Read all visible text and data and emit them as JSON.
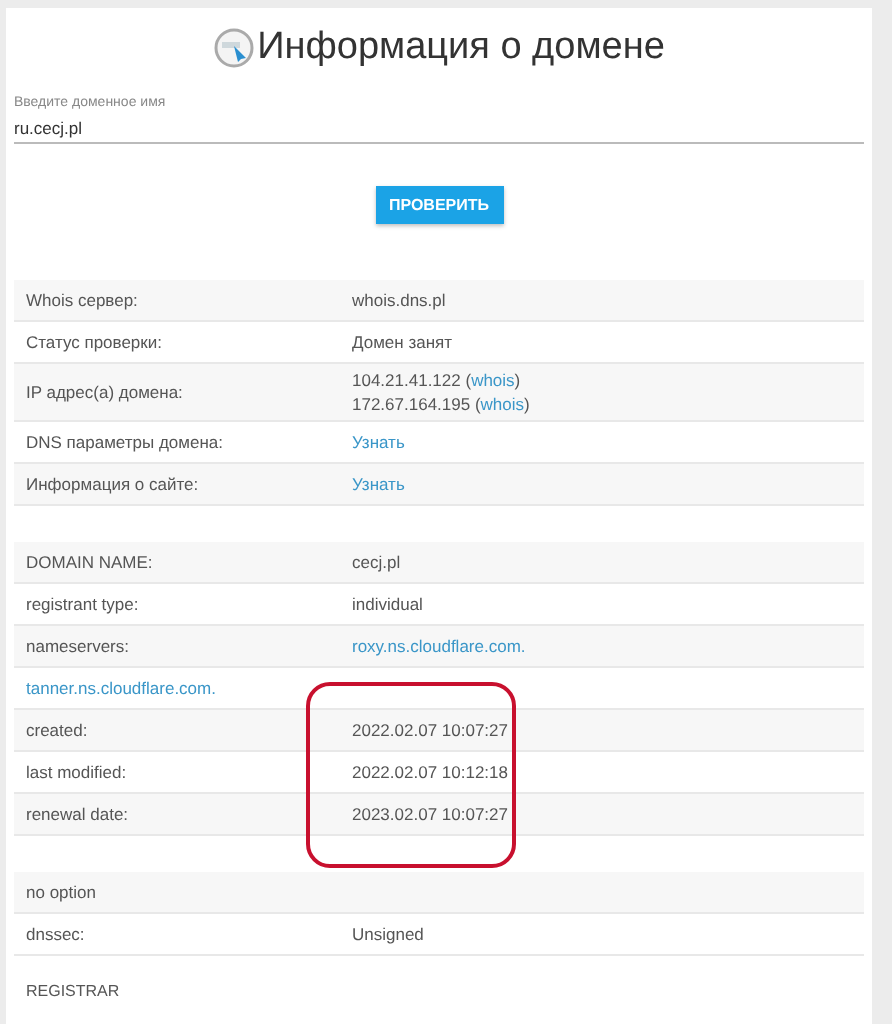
{
  "header": {
    "title": "Информация о домене"
  },
  "domain_field": {
    "label": "Введите доменное имя",
    "value": "ru.cecj.pl"
  },
  "check_button": {
    "label": "ПРОВЕРИТЬ"
  },
  "tables": [
    {
      "rows": [
        {
          "cells": [
            [
              [
                {
                  "text": "Whois сервер:",
                  "link": false
                }
              ]
            ],
            [
              [
                {
                  "text": "whois.dns.pl",
                  "link": false
                }
              ]
            ]
          ]
        },
        {
          "cells": [
            [
              [
                {
                  "text": "Статус проверки:",
                  "link": false
                }
              ]
            ],
            [
              [
                {
                  "text": "Домен занят",
                  "link": false
                }
              ]
            ]
          ]
        },
        {
          "cells": [
            [
              [
                {
                  "text": "IP адрес(а) домена:",
                  "link": false
                }
              ]
            ],
            [
              [
                {
                  "text": "104.21.41.122 (",
                  "link": false
                },
                {
                  "text": "whois",
                  "link": true
                },
                {
                  "text": ")",
                  "link": false
                }
              ],
              [
                {
                  "text": "172.67.164.195 (",
                  "link": false
                },
                {
                  "text": "whois",
                  "link": true
                },
                {
                  "text": ")",
                  "link": false
                }
              ]
            ]
          ]
        },
        {
          "cells": [
            [
              [
                {
                  "text": "DNS параметры домена:",
                  "link": false
                }
              ]
            ],
            [
              [
                {
                  "text": "Узнать",
                  "link": true
                }
              ]
            ]
          ]
        },
        {
          "cells": [
            [
              [
                {
                  "text": "Информация о сайте:",
                  "link": false
                }
              ]
            ],
            [
              [
                {
                  "text": "Узнать",
                  "link": true
                }
              ]
            ]
          ]
        }
      ]
    },
    {
      "rows": [
        {
          "cells": [
            [
              [
                {
                  "text": "DOMAIN NAME:",
                  "link": false
                }
              ]
            ],
            [
              [
                {
                  "text": "cecj.pl",
                  "link": false
                }
              ]
            ]
          ]
        },
        {
          "cells": [
            [
              [
                {
                  "text": "registrant type:",
                  "link": false
                }
              ]
            ],
            [
              [
                {
                  "text": "individual",
                  "link": false
                }
              ]
            ]
          ]
        },
        {
          "cells": [
            [
              [
                {
                  "text": "nameservers:",
                  "link": false
                }
              ]
            ],
            [
              [
                {
                  "text": "roxy.ns.cloudflare.com.",
                  "link": true
                }
              ]
            ]
          ]
        },
        {
          "cells": [
            [
              [
                {
                  "text": "tanner.ns.cloudflare.com.",
                  "link": true
                }
              ]
            ],
            []
          ]
        },
        {
          "cells": [
            [
              [
                {
                  "text": "created:",
                  "link": false
                }
              ]
            ],
            [
              [
                {
                  "text": "2022.02.07 10:07:27",
                  "link": false
                }
              ]
            ]
          ]
        },
        {
          "cells": [
            [
              [
                {
                  "text": "last modified:",
                  "link": false
                }
              ]
            ],
            [
              [
                {
                  "text": "2022.02.07 10:12:18",
                  "link": false
                }
              ]
            ]
          ]
        },
        {
          "cells": [
            [
              [
                {
                  "text": "renewal date:",
                  "link": false
                }
              ]
            ],
            [
              [
                {
                  "text": "2023.02.07 10:07:27",
                  "link": false
                }
              ]
            ]
          ]
        }
      ]
    },
    {
      "rows": [
        {
          "cells": [
            [
              [
                {
                  "text": "no option",
                  "link": false
                }
              ]
            ],
            []
          ]
        },
        {
          "cells": [
            [
              [
                {
                  "text": "dnssec:",
                  "link": false
                }
              ]
            ],
            [
              [
                {
                  "text": "Unsigned",
                  "link": false
                }
              ]
            ]
          ]
        }
      ]
    }
  ],
  "highlight_frame": true,
  "section_heading": "REGISTRAR"
}
